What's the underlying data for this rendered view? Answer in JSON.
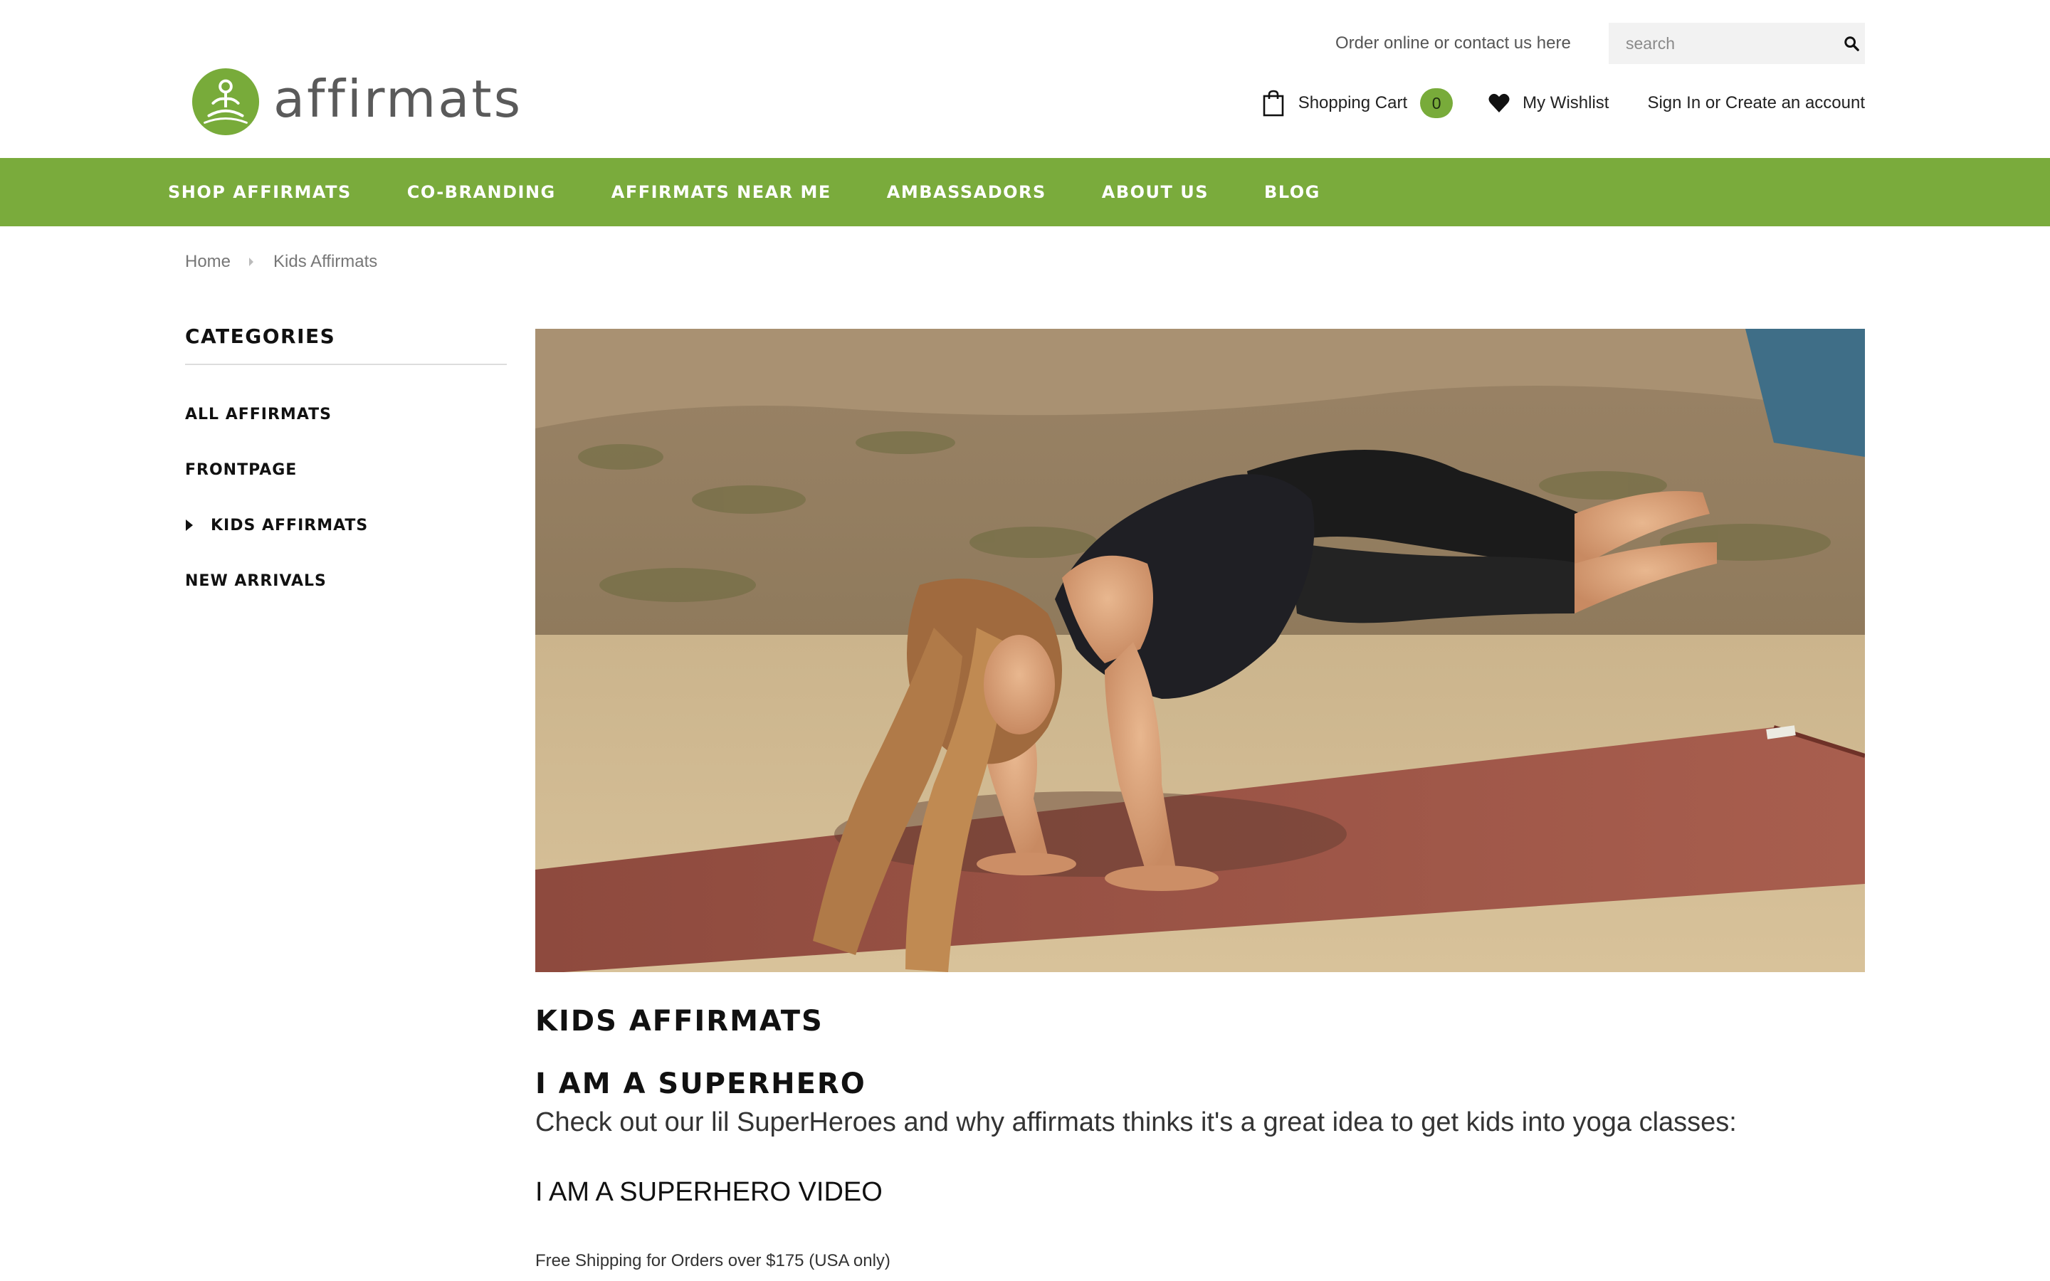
{
  "brand": {
    "name": "affirmats",
    "accent_color": "#7aab3c"
  },
  "header": {
    "contact_text": "Order online or contact us here",
    "search_placeholder": "search",
    "cart_label": "Shopping Cart",
    "cart_count": "0",
    "wishlist_label": "My Wishlist",
    "signin_label": "Sign In",
    "or_text": " or ",
    "create_label": "Create an account"
  },
  "nav": {
    "items": [
      {
        "label": "SHOP AFFIRMATS"
      },
      {
        "label": "CO-BRANDING"
      },
      {
        "label": "AFFIRMATS NEAR ME"
      },
      {
        "label": "AMBASSADORS"
      },
      {
        "label": "ABOUT US"
      },
      {
        "label": "BLOG"
      }
    ]
  },
  "breadcrumb": {
    "home": "Home",
    "current": "Kids Affirmats"
  },
  "sidebar": {
    "title": "CATEGORIES",
    "items": [
      {
        "label": "ALL AFFIRMATS"
      },
      {
        "label": "FRONTPAGE"
      },
      {
        "label": "KIDS AFFIRMATS",
        "active": true
      },
      {
        "label": "NEW ARRIVALS"
      }
    ]
  },
  "main": {
    "heading": "KIDS AFFIRMATS",
    "subheading": "I AM A SUPERHERO",
    "description": "Check out our lil SuperHeroes and why affirmats thinks it's a great idea to get kids into yoga classes:",
    "video_link": "I AM A SUPERHERO VIDEO",
    "shipping_note": "Free Shipping for Orders over $175 (USA only)"
  }
}
